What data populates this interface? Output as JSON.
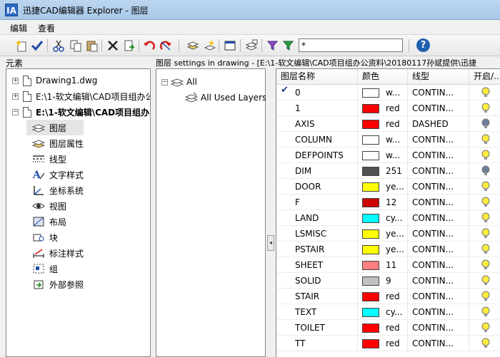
{
  "window": {
    "title": "迅捷CAD编辑器 Explorer - 图层",
    "app_icon_text": "IA"
  },
  "menu": {
    "items": [
      "编辑",
      "查看"
    ]
  },
  "toolbar": {
    "filter_value": "*",
    "help_label": "?"
  },
  "left": {
    "header": "元素",
    "files": [
      {
        "label": "Drawing1.dwg",
        "bold": false
      },
      {
        "label": "E:\\1-软文编辑\\CAD项目组办公",
        "bold": false
      },
      {
        "label": "E:\\1-软文编辑\\CAD项目组办",
        "bold": true
      }
    ],
    "children": [
      {
        "label": "图层",
        "icon": "layers-icon"
      },
      {
        "label": "图层属性",
        "icon": "layer-properties-icon"
      },
      {
        "label": "线型",
        "icon": "linetype-icon"
      },
      {
        "label": "文字样式",
        "icon": "text-style-icon"
      },
      {
        "label": "坐标系统",
        "icon": "ucs-icon"
      },
      {
        "label": "视图",
        "icon": "view-eye-icon"
      },
      {
        "label": "布局",
        "icon": "layout-icon"
      },
      {
        "label": "块",
        "icon": "block-icon"
      },
      {
        "label": "标注样式",
        "icon": "dimension-style-icon"
      },
      {
        "label": "组",
        "icon": "group-icon"
      },
      {
        "label": "外部参照",
        "icon": "xref-icon"
      }
    ]
  },
  "middle": {
    "header": "图层 settings in drawing - [E:\\1-软文编辑\\CAD项目组办公资料\\20180117孙斌提供\\迅捷",
    "root": "All",
    "child": "All Used Layers"
  },
  "table": {
    "columns": [
      "图层名称",
      "颜色",
      "线型",
      "开启/..."
    ],
    "rows": [
      {
        "name": "0",
        "color_hex": "#ffffff",
        "color_label": "w...",
        "linetype": "CONTIN...",
        "on": true,
        "current": true
      },
      {
        "name": "1",
        "color_hex": "#ff0000",
        "color_label": "red",
        "linetype": "CONTIN...",
        "on": true,
        "current": false
      },
      {
        "name": "AXIS",
        "color_hex": "#ff0000",
        "color_label": "red",
        "linetype": "DASHED",
        "on": false,
        "current": false
      },
      {
        "name": "COLUMN",
        "color_hex": "#ffffff",
        "color_label": "w...",
        "linetype": "CONTIN...",
        "on": true,
        "current": false
      },
      {
        "name": "DEFPOINTS",
        "color_hex": "#ffffff",
        "color_label": "w...",
        "linetype": "CONTIN...",
        "on": true,
        "current": false
      },
      {
        "name": "DIM",
        "color_hex": "#505050",
        "color_label": "251",
        "linetype": "CONTIN...",
        "on": false,
        "current": false
      },
      {
        "name": "DOOR",
        "color_hex": "#ffff00",
        "color_label": "ye...",
        "linetype": "CONTIN...",
        "on": true,
        "current": false
      },
      {
        "name": "F",
        "color_hex": "#cc0000",
        "color_label": "12",
        "linetype": "CONTIN...",
        "on": true,
        "current": false
      },
      {
        "name": "LAND",
        "color_hex": "#00ffff",
        "color_label": "cy...",
        "linetype": "CONTIN...",
        "on": true,
        "current": false
      },
      {
        "name": "LSMISC",
        "color_hex": "#ffff00",
        "color_label": "ye...",
        "linetype": "CONTIN...",
        "on": true,
        "current": false
      },
      {
        "name": "PSTAIR",
        "color_hex": "#ffff00",
        "color_label": "ye...",
        "linetype": "CONTIN...",
        "on": true,
        "current": false
      },
      {
        "name": "SHEET",
        "color_hex": "#ff7f7f",
        "color_label": "11",
        "linetype": "CONTIN...",
        "on": true,
        "current": false
      },
      {
        "name": "SOLID",
        "color_hex": "#c0c0c0",
        "color_label": "9",
        "linetype": "CONTIN...",
        "on": true,
        "current": false
      },
      {
        "name": "STAIR",
        "color_hex": "#ff0000",
        "color_label": "red",
        "linetype": "CONTIN...",
        "on": true,
        "current": false
      },
      {
        "name": "TEXT",
        "color_hex": "#00ffff",
        "color_label": "cy...",
        "linetype": "CONTIN...",
        "on": true,
        "current": false
      },
      {
        "name": "TOILET",
        "color_hex": "#ff0000",
        "color_label": "red",
        "linetype": "CONTIN...",
        "on": true,
        "current": false
      },
      {
        "name": "TT",
        "color_hex": "#ff0000",
        "color_label": "red",
        "linetype": "CONTIN...",
        "on": true,
        "current": false
      }
    ]
  }
}
